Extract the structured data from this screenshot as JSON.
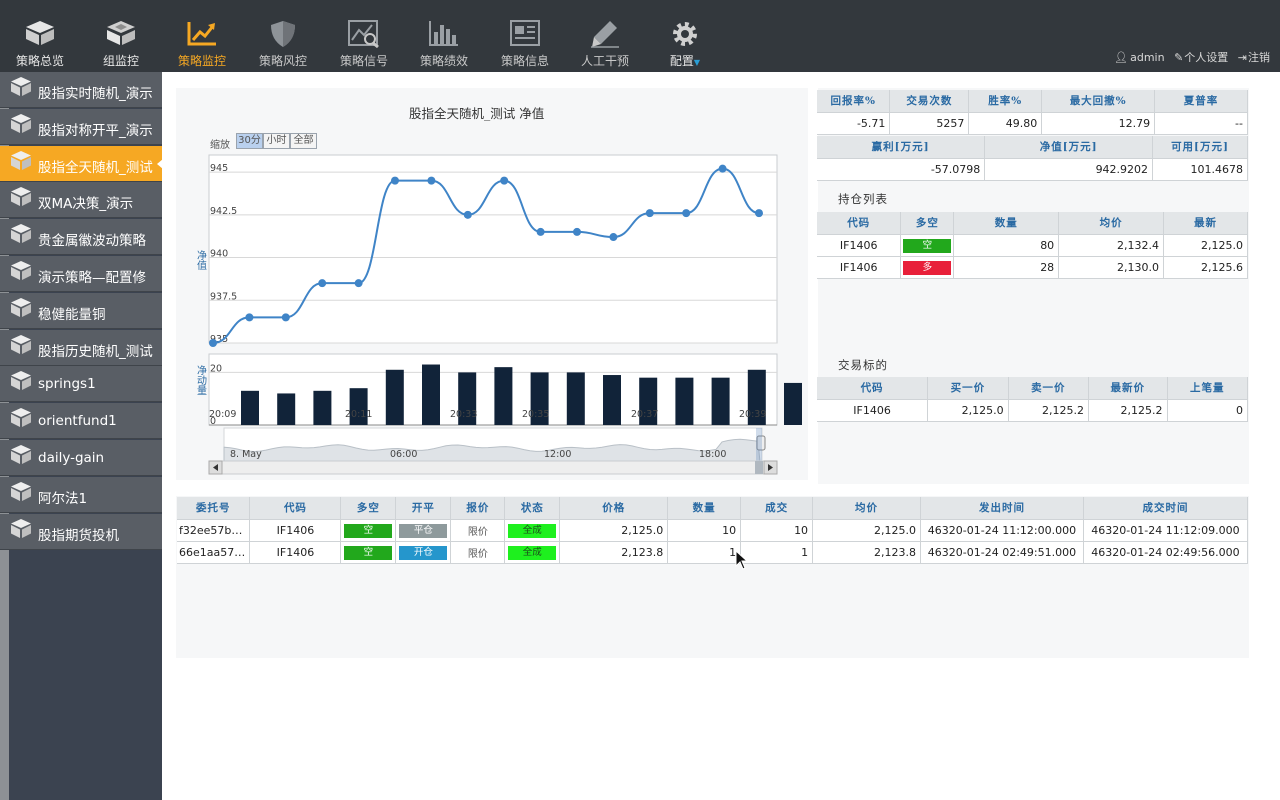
{
  "nav": {
    "items": [
      {
        "label": "策略总览",
        "icon": "cube-icon"
      },
      {
        "label": "组监控",
        "icon": "cubes-icon"
      },
      {
        "label": "策略监控",
        "icon": "chart-line-icon"
      },
      {
        "label": "策略风控",
        "icon": "shield-icon"
      },
      {
        "label": "策略信号",
        "icon": "signal-magnify-icon"
      },
      {
        "label": "策略绩效",
        "icon": "bar-chart-icon"
      },
      {
        "label": "策略信息",
        "icon": "newspaper-icon"
      },
      {
        "label": "人工干预",
        "icon": "pen-icon"
      },
      {
        "label": "配置",
        "icon": "gear-icon"
      }
    ],
    "user": {
      "name": "admin",
      "settings": "个人设置",
      "logout": "注销"
    }
  },
  "sidebar": {
    "items": [
      "股指实时随机_演示",
      "股指对称开平_演示",
      "股指全天随机_测试",
      "双MA决策_演示",
      "贵金属徽波动策略",
      "演示策略—配置修",
      "稳健能量铜",
      "股指历史随机_测试",
      "springs1",
      "orientfund1",
      "daily-gain",
      "阿尔法1",
      "股指期货投机"
    ],
    "active_index": 2
  },
  "chart_data": {
    "type": "line",
    "title": "股指全天随机_测试 净值",
    "zoom_label": "缩放",
    "zoom_buttons": [
      "30分",
      "小时",
      "全部"
    ],
    "zoom_selected": "30分",
    "ylabel": "净值",
    "ylim": [
      935,
      946
    ],
    "yticks": [
      935,
      937.5,
      940,
      942.5,
      945
    ],
    "series": [
      {
        "values": [
          935.0,
          936.5,
          936.5,
          938.5,
          938.5,
          944.5,
          944.5,
          942.5,
          944.5,
          941.5,
          941.5,
          941.2,
          942.6,
          942.6,
          945.2,
          942.6
        ]
      }
    ],
    "volume": {
      "ylabel": "净动量",
      "yticks": [
        0,
        20
      ],
      "ylim": [
        0,
        27
      ],
      "values": [
        13,
        12,
        13,
        14,
        21,
        23,
        20,
        22,
        20,
        20,
        19,
        18,
        18,
        18,
        21,
        16
      ]
    },
    "x_labels": [
      "20:09",
      "20:11",
      "20:33",
      "20:35",
      "20:37",
      "20:39"
    ],
    "navigator_labels": [
      "8. May",
      "06:00",
      "12:00",
      "18:00"
    ],
    "color": "#3f84c7"
  },
  "stats": {
    "headers1": [
      "回报率%",
      "交易次数",
      "胜率%",
      "最大回撤%",
      "夏普率"
    ],
    "row1": [
      "-5.71",
      "5257",
      "49.80",
      "12.79",
      "--"
    ],
    "headers2": [
      "赢利[万元]",
      "净值[万元]",
      "可用[万元]"
    ],
    "row2": [
      "-57.0798",
      "942.9202",
      "101.4678"
    ]
  },
  "positions": {
    "label": "持仓列表",
    "headers": [
      "代码",
      "多空",
      "数量",
      "均价",
      "最新"
    ],
    "rows": [
      {
        "code": "IF1406",
        "side": "空",
        "side_color": "#22a81c",
        "qty": "80",
        "avg": "2,132.4",
        "last": "2,125.0"
      },
      {
        "code": "IF1406",
        "side": "多",
        "side_color": "#e8203a",
        "qty": "28",
        "avg": "2,130.0",
        "last": "2,125.6"
      }
    ]
  },
  "instruments": {
    "label": "交易标的",
    "headers": [
      "代码",
      "买一价",
      "卖一价",
      "最新价",
      "上笔量"
    ],
    "rows": [
      {
        "code": "IF1406",
        "bid": "2,125.0",
        "ask": "2,125.2",
        "last": "2,125.2",
        "vol": "0"
      }
    ]
  },
  "orders": {
    "headers": [
      "委托号",
      "代码",
      "多空",
      "开平",
      "报价",
      "状态",
      "价格",
      "数量",
      "成交",
      "均价",
      "发出时间",
      "成交时间"
    ],
    "rows": [
      {
        "id": "f32ee57b…",
        "code": "IF1406",
        "side": "空",
        "side_color": "#22a81c",
        "oc": "平仓",
        "oc_color": "#8e9a9c",
        "quote": "限价",
        "status": "全成",
        "status_color": "#1ef01e",
        "price": "2,125.0",
        "qty": "10",
        "filled": "10",
        "avg": "2,125.0",
        "sent": "46320-01-24 11:12:00.000",
        "done": "46320-01-24 11:12:09.000"
      },
      {
        "id": "66e1aa57…",
        "code": "IF1406",
        "side": "空",
        "side_color": "#22a81c",
        "oc": "开仓",
        "oc_color": "#2596cc",
        "quote": "限价",
        "status": "全成",
        "status_color": "#1ef01e",
        "price": "2,123.8",
        "qty": "1",
        "filled": "1",
        "avg": "2,123.8",
        "sent": "46320-01-24 02:49:51.000",
        "done": "46320-01-24 02:49:56.000"
      }
    ]
  },
  "colors": {
    "accent": "#f6a823",
    "topbar": "#33383d",
    "sidebar_item": "#595e65",
    "header_text": "#2a6aa3"
  }
}
